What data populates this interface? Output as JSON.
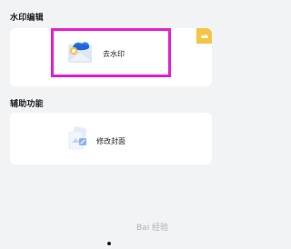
{
  "sections": {
    "watermark_edit": {
      "title": "水印编辑",
      "item_label": "去水印"
    },
    "aux_functions": {
      "title": "辅助功能",
      "item_label": "修改封面"
    }
  },
  "watermark_text": "Bai 经验",
  "colors": {
    "background": "#f2f3f5",
    "card": "#ffffff",
    "highlight": "#e61fd4",
    "ribbon": "#f6c445",
    "icon_blue": "#2f7df6"
  }
}
